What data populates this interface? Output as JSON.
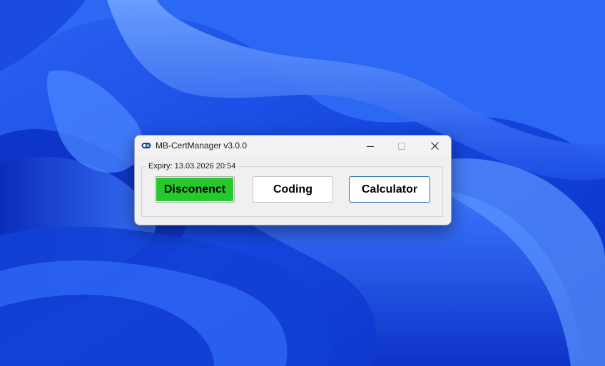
{
  "window": {
    "title": "MB-CertManager v3.0.0",
    "icon": "app-logo-icon",
    "controls": {
      "minimize": "minimize-icon",
      "maximize": "maximize-icon",
      "close": "close-icon"
    }
  },
  "group": {
    "legend": "Expiry: 13.03.2026 20:54"
  },
  "buttons": {
    "disconnect_label": "Disconenct",
    "coding_label": "Coding",
    "calculator_label": "Calculator"
  },
  "colors": {
    "disconnect_bg": "#26c82e",
    "accent_border": "#2a6fb0",
    "wallpaper_base": "#1e4fe6"
  }
}
